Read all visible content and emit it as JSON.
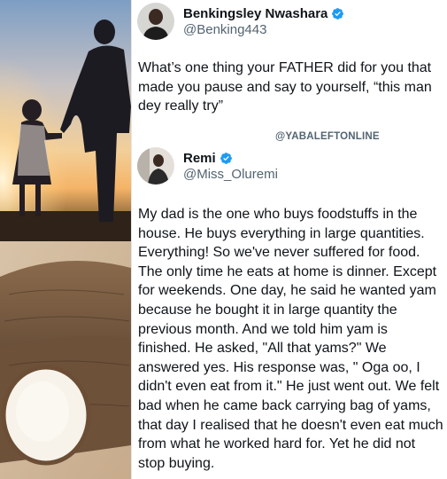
{
  "original_post": {
    "display_name": "Benkingsley Nwashara",
    "handle": "@Benking443",
    "text": "What’s one thing your FATHER did for you that made you pause and say to yourself, “this man dey really try”"
  },
  "watermark": "@YABALEFTONLINE",
  "reply_post": {
    "display_name": "Remi",
    "handle": "@Miss_Oluremi",
    "text": "My dad is the one who buys foodstuffs in the house. He buys everything in large quantities. Everything! So we've never suffered for food. The only time he eats at home is dinner. Except for weekends. One day, he said he wanted yam because he bought it in large quantity the previous month. And we told him yam is finished. He asked, \"All that yams?\" We answered yes. His response was, \" Oga oo, I didn't even eat from it.\" He just went out. We felt bad when he came back carrying bag of yams, that day I realised that he doesn't even eat much from what he worked hard for. Yet he did not stop buying."
  },
  "colors": {
    "verified_blue": "#1d9bf0",
    "text_primary": "#0f1419",
    "text_secondary": "#536471"
  },
  "icons": {
    "verified": "verified-badge-icon"
  }
}
